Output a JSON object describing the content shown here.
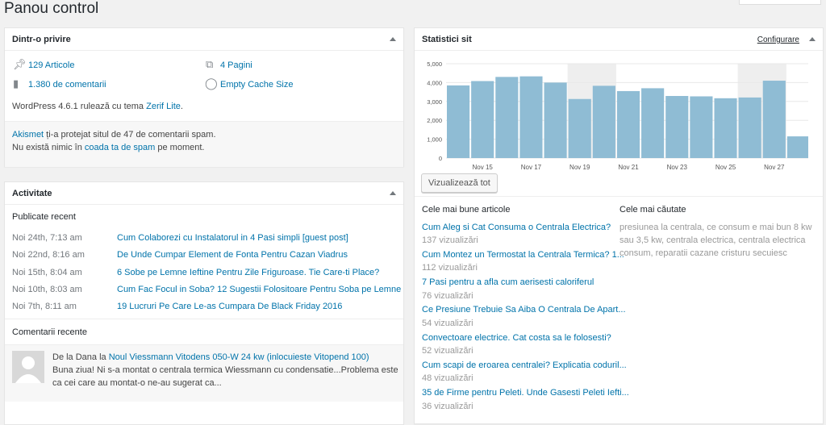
{
  "page": {
    "title": "Panou control"
  },
  "glance": {
    "title": "Dintr-o privire",
    "posts": "129 Articole",
    "pages": "4 Pagini",
    "comments": "1.380 de comentarii",
    "cache": "Empty Cache Size",
    "version_prefix": "WordPress 4.6.1 rulează cu tema ",
    "theme": "Zerif Lite",
    "version_suffix": ".",
    "akismet_link": "Akismet",
    "akismet_text": " ți-a protejat situl de 47 de comentarii spam.",
    "spam_prefix": "Nu există nimic în ",
    "spam_link": "coada ta de spam",
    "spam_suffix": " pe moment."
  },
  "activity": {
    "title": "Activitate",
    "published_heading": "Publicate recent",
    "posts": [
      {
        "date": "Noi 24th, 7:13 am",
        "title": "Cum Colaborezi cu Instalatorul in 4 Pasi simpli [guest post]"
      },
      {
        "date": "Noi 22nd, 8:16 am",
        "title": "De Unde Cumpar Element de Fonta Pentru Cazan Viadrus"
      },
      {
        "date": "Noi 15th, 8:04 am",
        "title": "6 Sobe pe Lemne Ieftine Pentru Zile Friguroase. Tie Care-ti Place?"
      },
      {
        "date": "Noi 10th, 8:03 am",
        "title": "Cum Fac Focul in Soba? 12 Sugestii Folositoare Pentru Soba pe Lemne"
      },
      {
        "date": "Noi 7th, 8:11 am",
        "title": "19 Lucruri Pe Care Le-as Cumpara De Black Friday 2016"
      }
    ],
    "comments_heading": "Comentarii recente",
    "comment": {
      "from": "De la Dana la ",
      "post_link": "Noul Viessmann Vitodens 050-W 24 kw (inlocuieste Vitopend 100)",
      "line1": "Buna ziua! Ni s-a montat o centrala termica Wiessmann cu condensatie...Problema este",
      "line2": "ca cei care au montat-o ne-au sugerat ca..."
    }
  },
  "stats": {
    "title": "Statistici sit",
    "configure": "Configurare",
    "view_all": "Vizualizează tot",
    "best_articles_heading": "Cele mai bune articole",
    "searches_heading": "Cele mai căutate",
    "top_posts": [
      {
        "title": "Cum Aleg si Cat Consuma o Centrala Electrica?",
        "views": "137 vizualizări"
      },
      {
        "title": "Cum Montez un Termostat la Centrala Termica? 1...",
        "views": "112 vizualizări"
      },
      {
        "title": "7 Pasi pentru a afla cum aerisesti caloriferul",
        "views": "76 vizualizări"
      },
      {
        "title": "Ce Presiune Trebuie Sa Aiba O Centrala De Apart...",
        "views": "54 vizualizări"
      },
      {
        "title": "Convectoare electrice. Cat costa sa le folosesti?",
        "views": "52 vizualizări"
      },
      {
        "title": "Cum scapi de eroarea centralei? Explicatia coduril...",
        "views": "48 vizualizări"
      },
      {
        "title": "35 de Firme pentru Peleti. Unde Gasesti Peleti Iefti...",
        "views": "36 vizualizări"
      }
    ],
    "searches": {
      "line1": "presiunea la centrala,  ce consum e mai bun 8 kw",
      "line2": "sau 3,5 kw,  centrala electrica,  centrala electrica",
      "line3": "consum,  reparatii cazane cristuru secuiesc"
    }
  },
  "chart_data": {
    "type": "bar",
    "x_tick_labels": [
      "Nov 15",
      "Nov 17",
      "Nov 19",
      "Nov 21",
      "Nov 23",
      "Nov 25",
      "Nov 27"
    ],
    "y_tick_labels": [
      "5,000",
      "4,000",
      "3,000",
      "2,000",
      "1,000",
      "0"
    ],
    "values": [
      3850,
      4080,
      4300,
      4330,
      4000,
      3130,
      3830,
      3550,
      3700,
      3290,
      3270,
      3170,
      3210,
      4100,
      1150
    ],
    "ylim": [
      0,
      5000
    ],
    "weekend_band_bar_indices": [
      5,
      6,
      12,
      13
    ],
    "bar_color": "#8fbcd4",
    "weekend_color": "#eeeeee"
  },
  "colors": {
    "link": "#0073aa",
    "background": "#f1f1f1"
  }
}
